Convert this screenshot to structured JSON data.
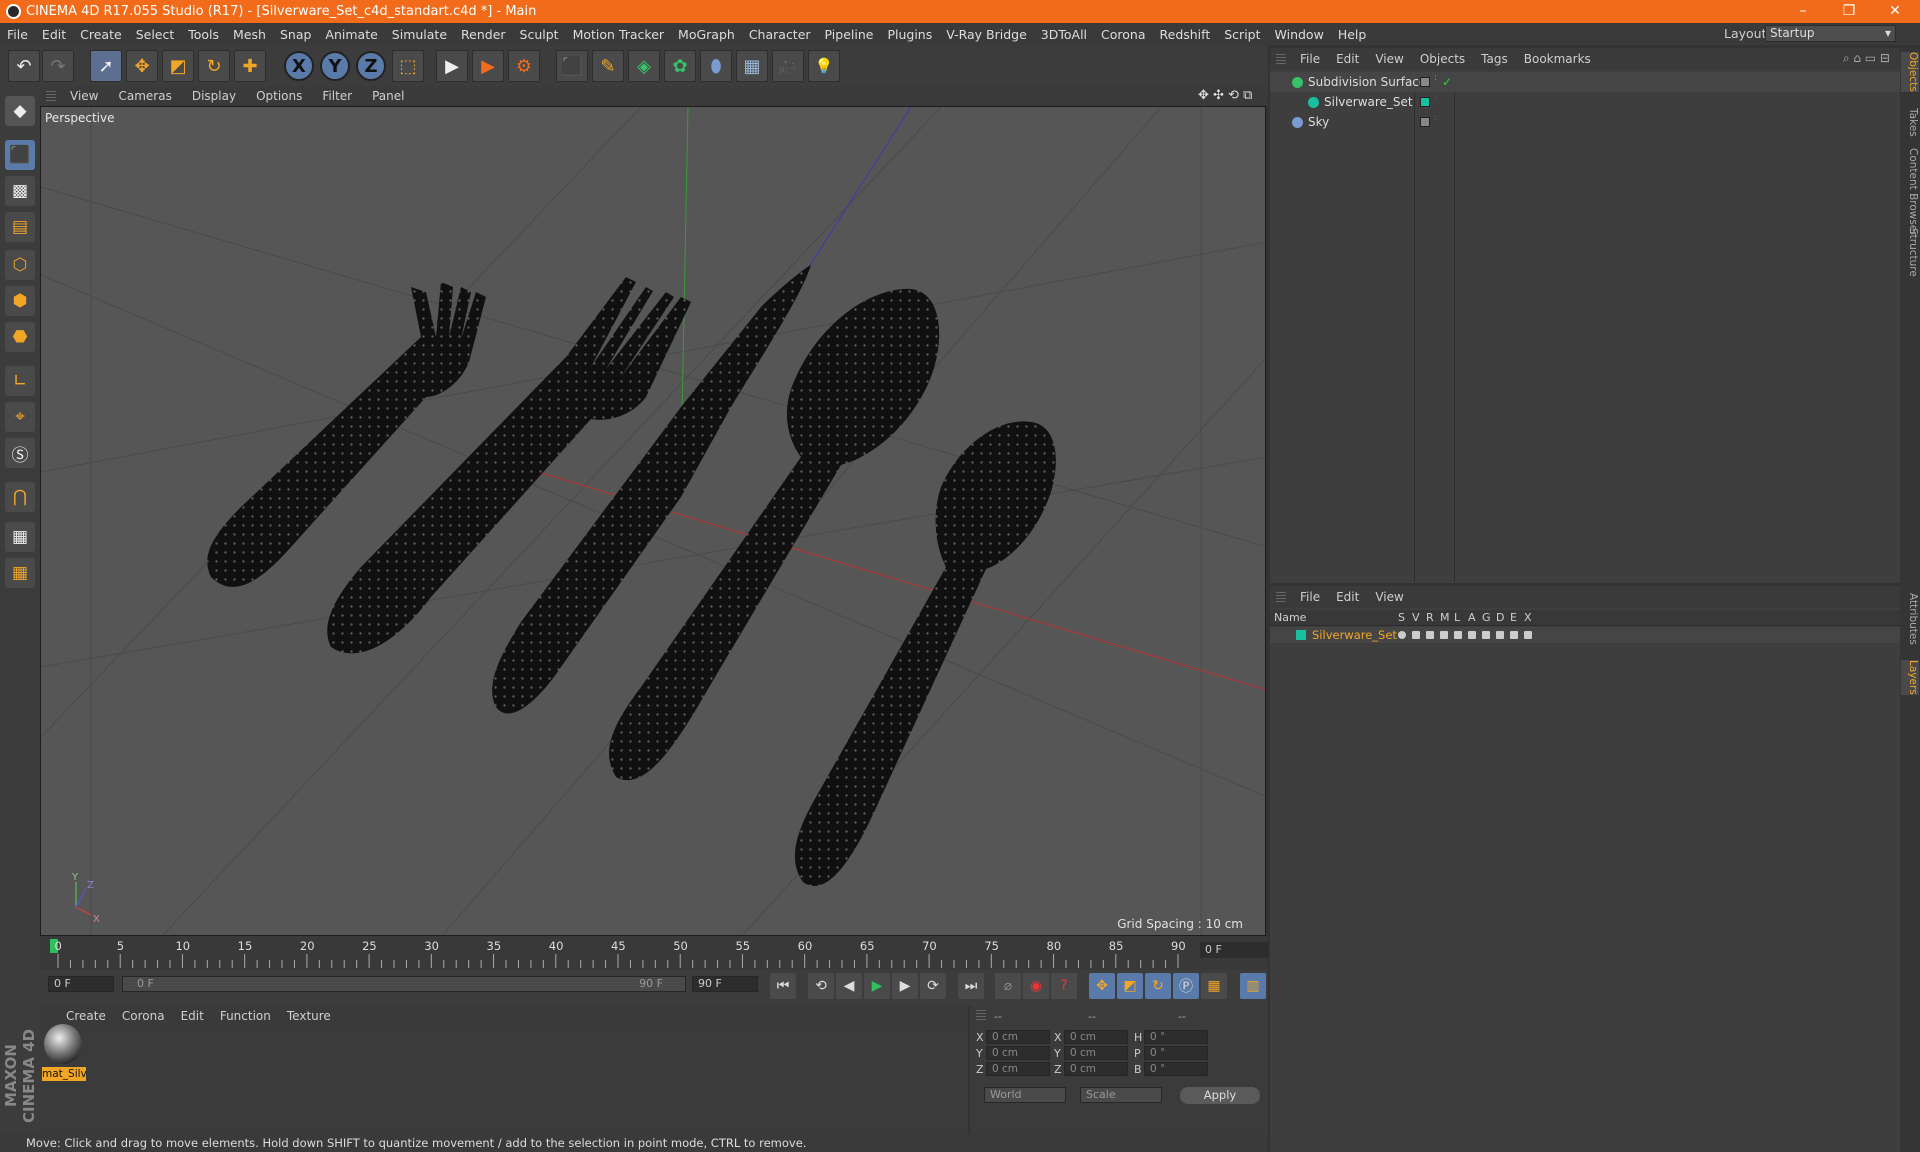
{
  "window": {
    "title": "CINEMA 4D R17.055 Studio (R17) - [Silverware_Set_c4d_standart.c4d *] - Main",
    "minimize": "–",
    "maximize": "❐",
    "close": "✕"
  },
  "menubar": {
    "items": [
      "File",
      "Edit",
      "Create",
      "Select",
      "Tools",
      "Mesh",
      "Snap",
      "Animate",
      "Simulate",
      "Render",
      "Sculpt",
      "Motion Tracker",
      "MoGraph",
      "Character",
      "Pipeline",
      "Plugins",
      "V-Ray Bridge",
      "3DToAll",
      "Corona",
      "Redshift",
      "Script",
      "Window",
      "Help"
    ],
    "layout_label": "Layout:",
    "layout_value": "Startup"
  },
  "toolbar": {
    "undo": "↶",
    "redo": "↷",
    "select": "➚",
    "move": "✥",
    "scale": "◩",
    "rotate": "↻",
    "add": "✚",
    "x": "X",
    "y": "Y",
    "z": "Z",
    "coord": "⬚",
    "render_view": "▶",
    "render": "▶",
    "render_settings": "⚙",
    "cube": "⬛",
    "pen": "✎",
    "subdiv": "◈",
    "array": "✿",
    "deformer": "⬮",
    "floor": "▦",
    "camera": "🎥",
    "light": "💡"
  },
  "viewport": {
    "menu": [
      "View",
      "Cameras",
      "Display",
      "Options",
      "Filter",
      "Panel"
    ],
    "label": "Perspective",
    "grid_spacing": "Grid Spacing : 10 cm",
    "axis_y": "Y",
    "axis_z": "Z",
    "axis_x": "X"
  },
  "timeline": {
    "ticks": [
      "0",
      "5",
      "10",
      "15",
      "20",
      "25",
      "30",
      "35",
      "40",
      "45",
      "50",
      "55",
      "60",
      "65",
      "70",
      "75",
      "80",
      "85",
      "90"
    ],
    "current_frame": "0 F",
    "start_field": "0 F",
    "range_start": "0 F",
    "range_end": "90 F",
    "end_field": "90 F"
  },
  "materials": {
    "menu": [
      "Create",
      "Corona",
      "Edit",
      "Function",
      "Texture"
    ],
    "items": [
      {
        "label": "mat_Silv"
      }
    ]
  },
  "coordinates": {
    "header": [
      "--",
      "--",
      "--"
    ],
    "rows": [
      {
        "a": "X",
        "av": "0 cm",
        "b": "X",
        "bv": "0 cm",
        "c": "H",
        "cv": "0 °"
      },
      {
        "a": "Y",
        "av": "0 cm",
        "b": "Y",
        "bv": "0 cm",
        "c": "P",
        "cv": "0 °"
      },
      {
        "a": "Z",
        "av": "0 cm",
        "b": "Z",
        "bv": "0 cm",
        "c": "B",
        "cv": "0 °"
      }
    ],
    "mode": "World",
    "scale": "Scale",
    "apply": "Apply"
  },
  "status": "Move: Click and drag to move elements. Hold down SHIFT to quantize movement / add to the selection in point mode, CTRL to remove.",
  "objects": {
    "menu": [
      "File",
      "Edit",
      "View",
      "Objects",
      "Tags",
      "Bookmarks"
    ],
    "rows": [
      {
        "name": "Subdivision Surface",
        "color": "#38c06a"
      },
      {
        "name": "Silverware_Set",
        "color": "#19c0a0"
      },
      {
        "name": "Sky",
        "color": "#7a9bd0"
      }
    ]
  },
  "layers": {
    "menu": [
      "File",
      "Edit",
      "View"
    ],
    "columns": [
      "Name",
      "S",
      "V",
      "R",
      "M",
      "L",
      "A",
      "G",
      "D",
      "E",
      "X"
    ],
    "rows": [
      {
        "name": "Silverware_Set",
        "color": "#19c0a0"
      }
    ]
  },
  "side_tabs": [
    "Objects",
    "Takes",
    "Content Browser",
    "Structure",
    "Attributes",
    "Layers"
  ],
  "brand": "MAXON CINEMA 4D"
}
